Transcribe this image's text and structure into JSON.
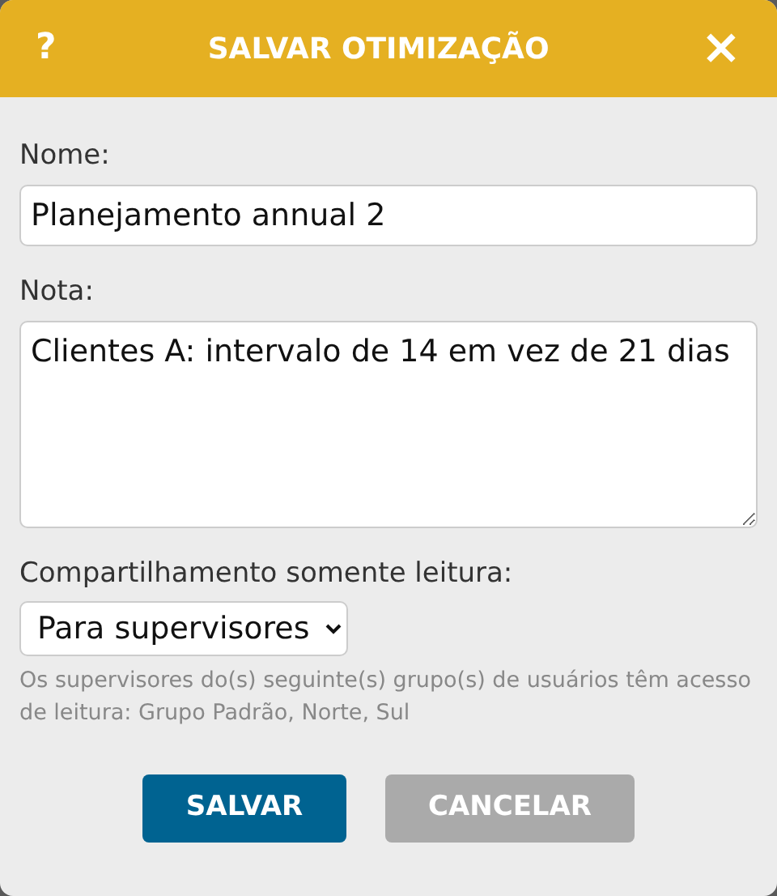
{
  "dialog": {
    "title": "SALVAR OTIMIZAÇÃO",
    "help": "?",
    "close": "×"
  },
  "fields": [
    {
      "kind": "input",
      "label": "Nome:",
      "value": "Planejamento annual 2"
    },
    {
      "kind": "textarea",
      "label": "Nota:",
      "value": "Clientes A: intervalo de 14 em vez de 21 dias"
    },
    {
      "kind": "select",
      "label": "Compartilhamento somente leitura:",
      "value": "Para supervisores"
    }
  ],
  "hint": "Os supervisores do(s) seguinte(s) grupo(s) de usuários têm acesso de leitura: Grupo Padrão, Norte, Sul",
  "buttons": [
    {
      "label": "SALVAR",
      "kind": "primary"
    },
    {
      "label": "CANCELAR",
      "kind": "secondary"
    }
  ]
}
